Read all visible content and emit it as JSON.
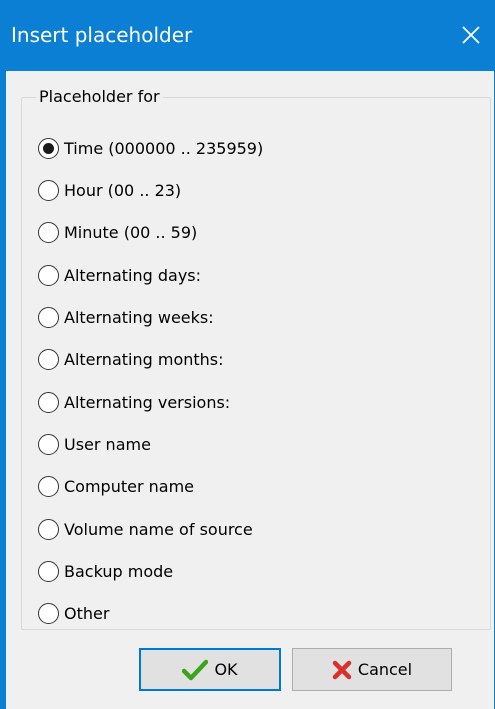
{
  "window": {
    "title": "Insert placeholder",
    "close_icon": "close-icon"
  },
  "group": {
    "legend": "Placeholder for",
    "selected_index": 0,
    "options": [
      "Time (000000 .. 235959)",
      "Hour (00 .. 23)",
      "Minute (00 .. 59)",
      "Alternating days:",
      "Alternating weeks:",
      "Alternating months:",
      "Alternating versions:",
      "User name",
      "Computer name",
      "Volume name of source",
      "Backup mode",
      "Other"
    ]
  },
  "buttons": {
    "ok_label": "OK",
    "ok_icon": "checkmark-icon",
    "cancel_label": "Cancel",
    "cancel_icon": "red-x-icon"
  },
  "colors": {
    "accent": "#0b7fd4",
    "ok_check": "#3aa51a",
    "cancel_x": "#d9302c"
  }
}
